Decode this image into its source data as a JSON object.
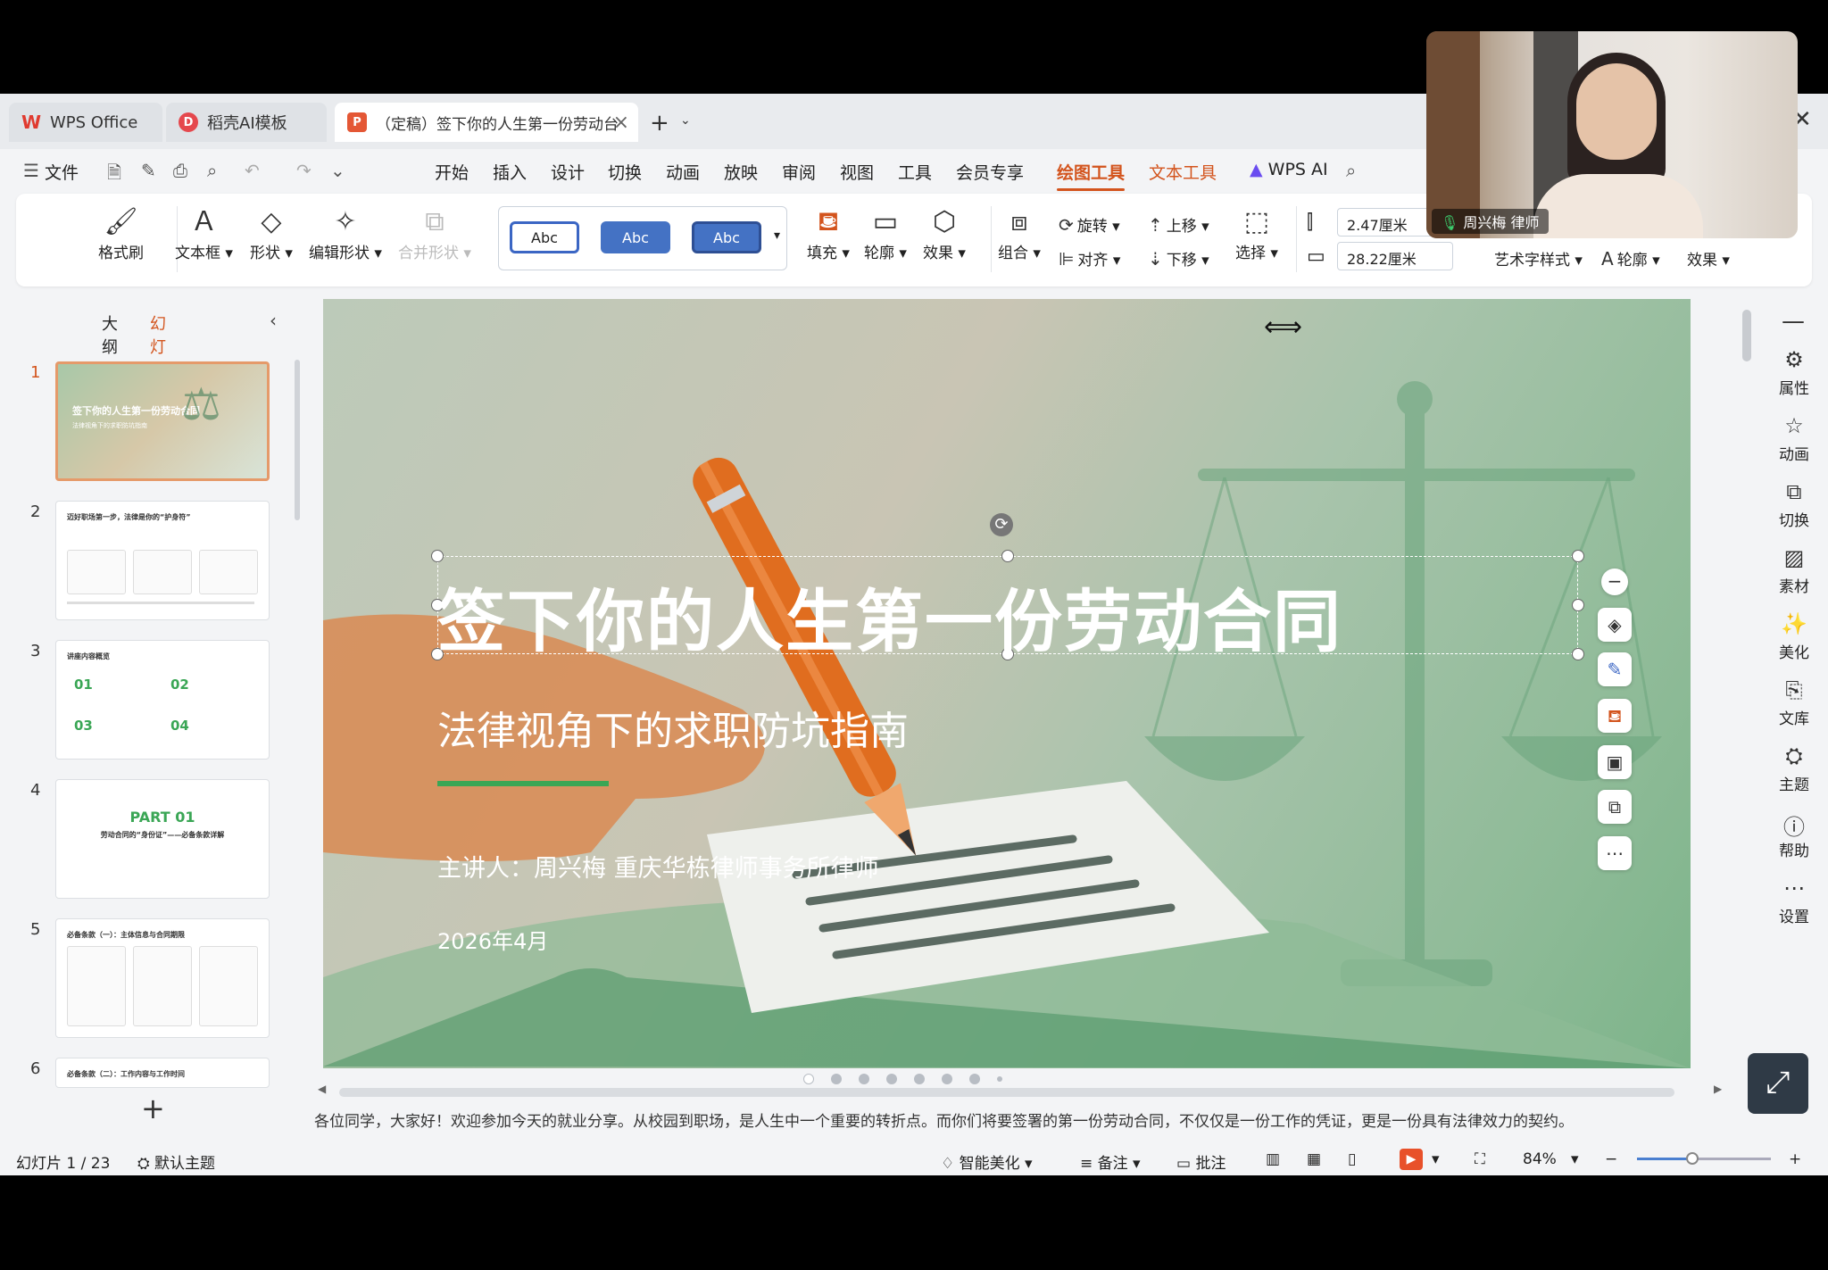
{
  "tabs": {
    "wps": "WPS Office",
    "ai_template": "稻壳AI模板",
    "document": "（定稿）签下你的人生第一份劳动台",
    "add": "+",
    "close": "×"
  },
  "menu": {
    "file": "文件",
    "items": [
      "开始",
      "插入",
      "设计",
      "切换",
      "动画",
      "放映",
      "审阅",
      "视图",
      "工具",
      "会员专享",
      "绘图工具",
      "文本工具"
    ],
    "wps_ai": "WPS AI"
  },
  "ribbon": {
    "format_painter": "格式刷",
    "textbox": "文本框",
    "shape": "形状",
    "edit_shape": "编辑形状",
    "merge_shape": "合并形状",
    "style_samples": [
      "Abc",
      "Abc",
      "Abc"
    ],
    "fill": "填充",
    "outline": "轮廓",
    "effect": "效果",
    "group": "组合",
    "rotate": "旋转",
    "align": "对齐",
    "bring_forward": "上移",
    "send_backward": "下移",
    "select": "选择",
    "height": "2.47厘米",
    "width": "28.22厘米",
    "art_style": "艺术字样式",
    "text_outline": "轮廓",
    "text_effect": "效果"
  },
  "left_panel": {
    "tab_outline": "大纲",
    "tab_slides": "幻灯片",
    "thumbnails": [
      {
        "num": "1",
        "title": "签下你的人生第一份劳动合同",
        "subtitle": "法律视角下的求职防坑指南"
      },
      {
        "num": "2",
        "title": "迈好职场第一步，法律是你的“护身符”"
      },
      {
        "num": "3",
        "title": "讲座内容概览",
        "items": [
          "01",
          "02",
          "03",
          "04"
        ]
      },
      {
        "num": "4",
        "title": "PART 01",
        "subtitle": "劳动合同的“身份证”——必备条款详解"
      },
      {
        "num": "5",
        "title": "必备条款（一）：主体信息与合同期限"
      },
      {
        "num": "6",
        "title": "必备条款（二）：工作内容与工作时间"
      }
    ],
    "add": "+"
  },
  "slide": {
    "title": "签下你的人生第一份劳动合同",
    "subtitle": "法律视角下的求职防坑指南",
    "presenter": "主讲人：周兴梅  重庆华栋律师事务所律师",
    "date": "2026年4月"
  },
  "notes": "各位同学，大家好！欢迎参加今天的就业分享。从校园到职场，是人生中一个重要的转折点。而你们将要签署的第一份劳动合同，不仅仅是一份工作的凭证，更是一份具有法律效力的契约。",
  "right_bar": [
    "属性",
    "动画",
    "切换",
    "素材",
    "美化",
    "文库",
    "主题",
    "帮助",
    "设置"
  ],
  "status": {
    "slide_count": "幻灯片 1 / 23",
    "theme": "默认主题",
    "smart_beautify": "智能美化",
    "notes": "备注",
    "comments": "批注",
    "zoom": "84%",
    "zoom_fraction": 0.41
  },
  "video": {
    "name": "周兴梅 律师"
  },
  "colors": {
    "accent": "#d3541d",
    "slide_green": "#3aa655"
  }
}
